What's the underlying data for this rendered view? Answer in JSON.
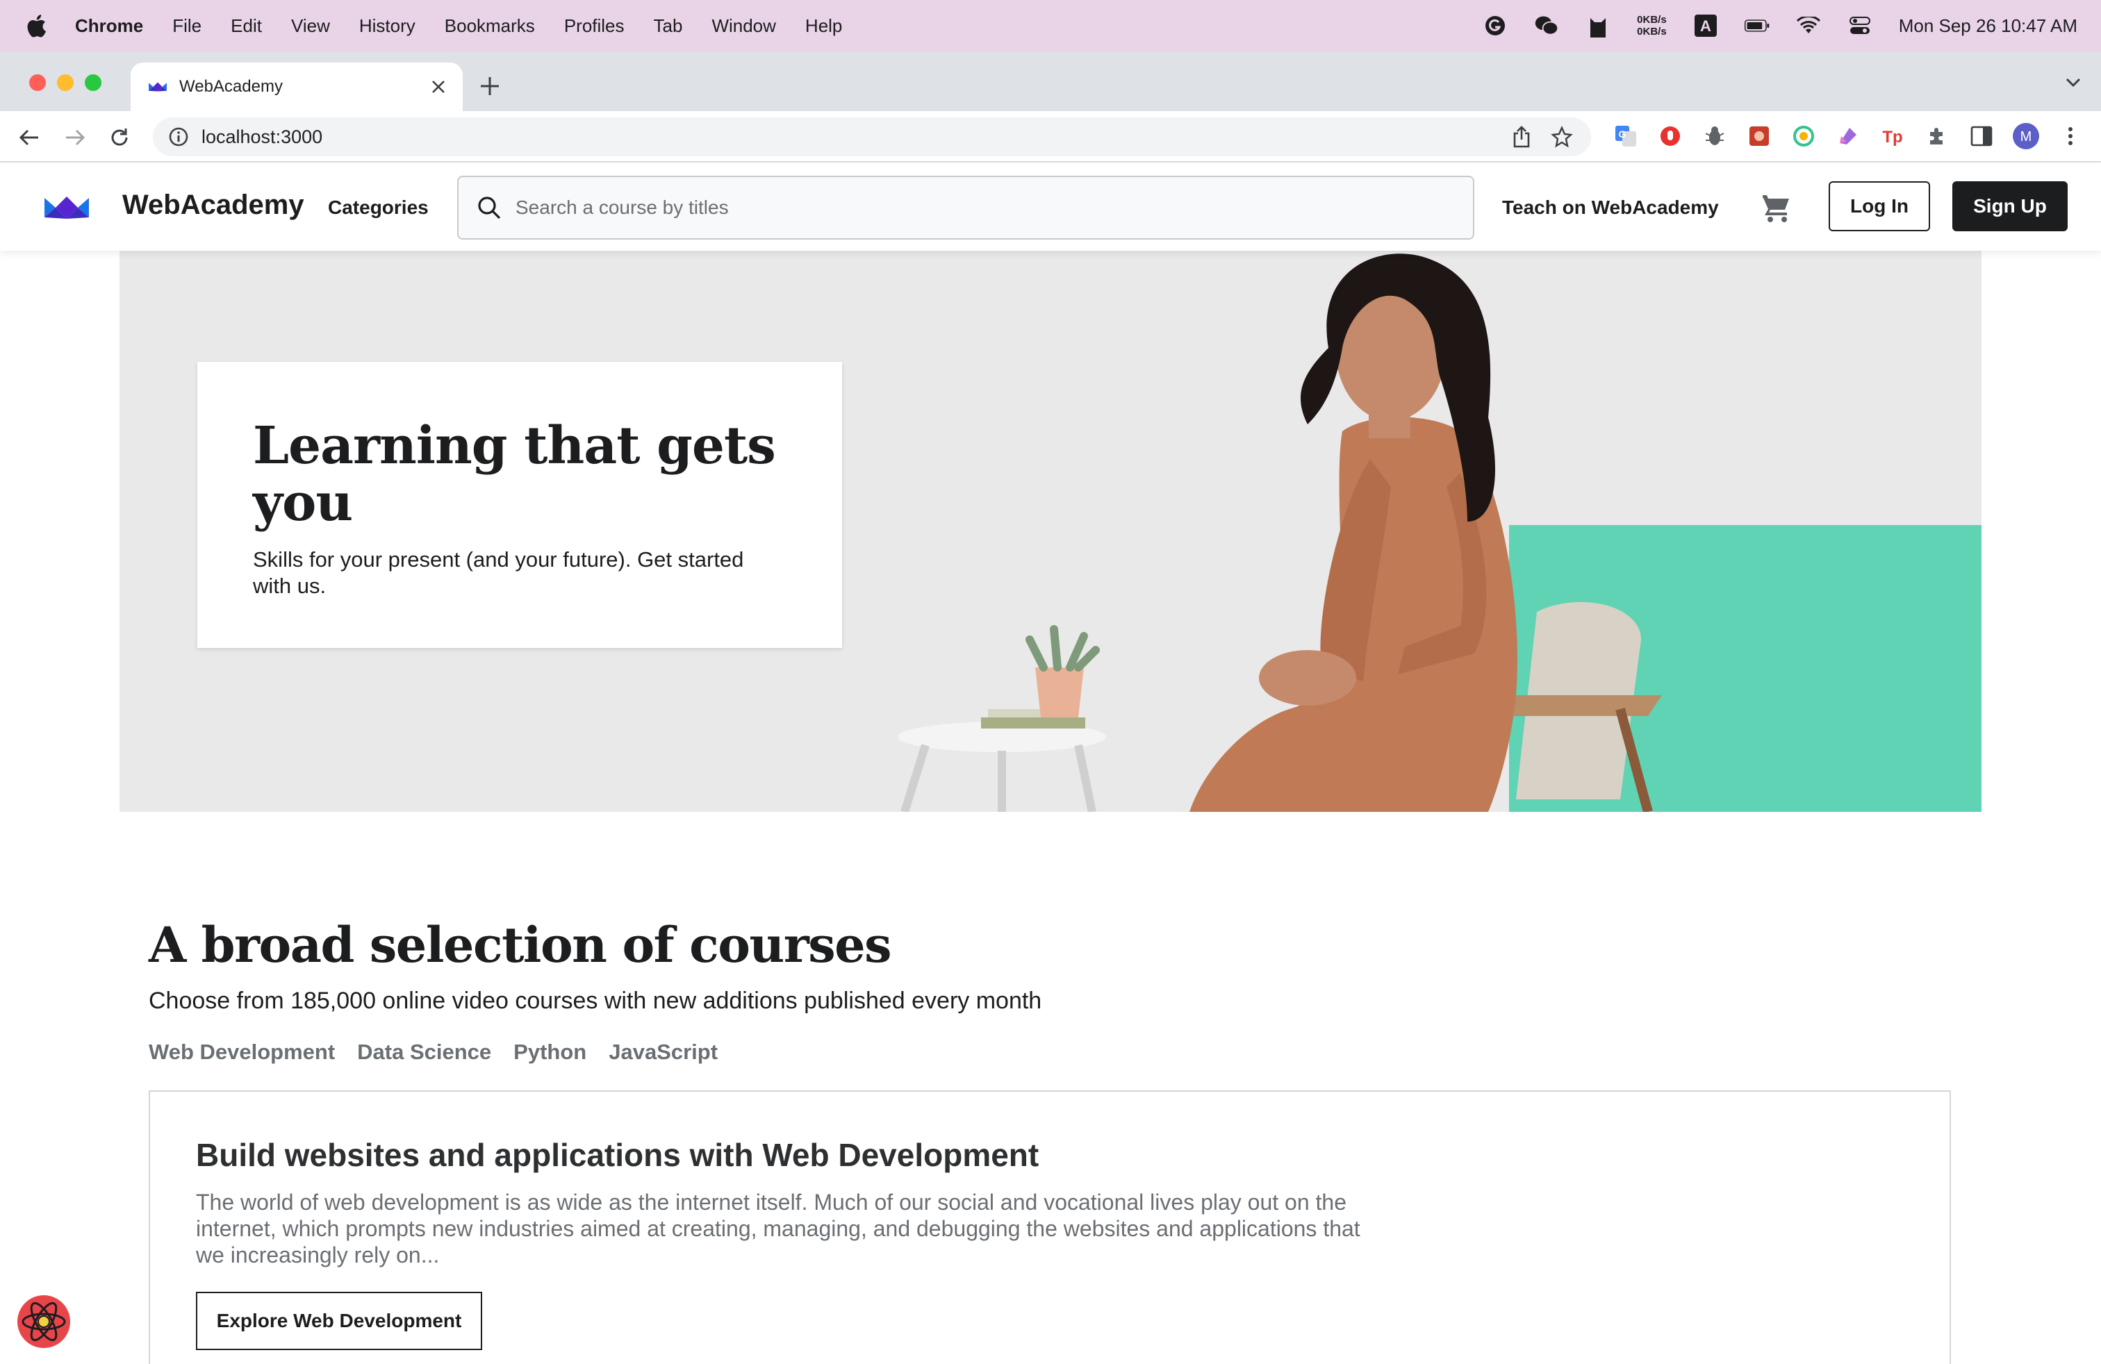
{
  "menubar": {
    "app": "Chrome",
    "items": [
      "File",
      "Edit",
      "View",
      "History",
      "Bookmarks",
      "Profiles",
      "Tab",
      "Window",
      "Help"
    ],
    "speed_up": "0KB/s",
    "speed_down": "0KB/s",
    "input_letter": "A",
    "clock": "Mon Sep 26  10:47 AM"
  },
  "browser": {
    "tab_title": "WebAcademy",
    "url": "localhost:3000",
    "profile_initial": "M"
  },
  "header": {
    "brand": "WebAcademy",
    "categories": "Categories",
    "search_placeholder": "Search a course by titles",
    "teach": "Teach on WebAcademy",
    "login": "Log In",
    "signup": "Sign Up"
  },
  "hero": {
    "title": "Learning that gets you",
    "subtitle": "Skills for your present (and your future). Get started with us."
  },
  "courses": {
    "title": "A broad selection of courses",
    "subtitle": "Choose from 185,000 online video courses with new additions published every month",
    "tabs": [
      "Web Development",
      "Data Science",
      "Python",
      "JavaScript"
    ],
    "card": {
      "title": "Build websites and applications with Web Development",
      "description": "The world of web development is as wide as the internet itself. Much of our social and vocational lives play out on the internet, which prompts new industries aimed at creating, managing, and debugging the websites and applications that we increasingly rely on...",
      "button": "Explore Web Development"
    }
  },
  "colors": {
    "menubar_bg": "#e9d3e7",
    "brand_dark": "#1c1d1f",
    "hero_teal": "#5fd3b3",
    "logo_purple": "#5624d0",
    "logo_blue": "#1a73e8"
  }
}
